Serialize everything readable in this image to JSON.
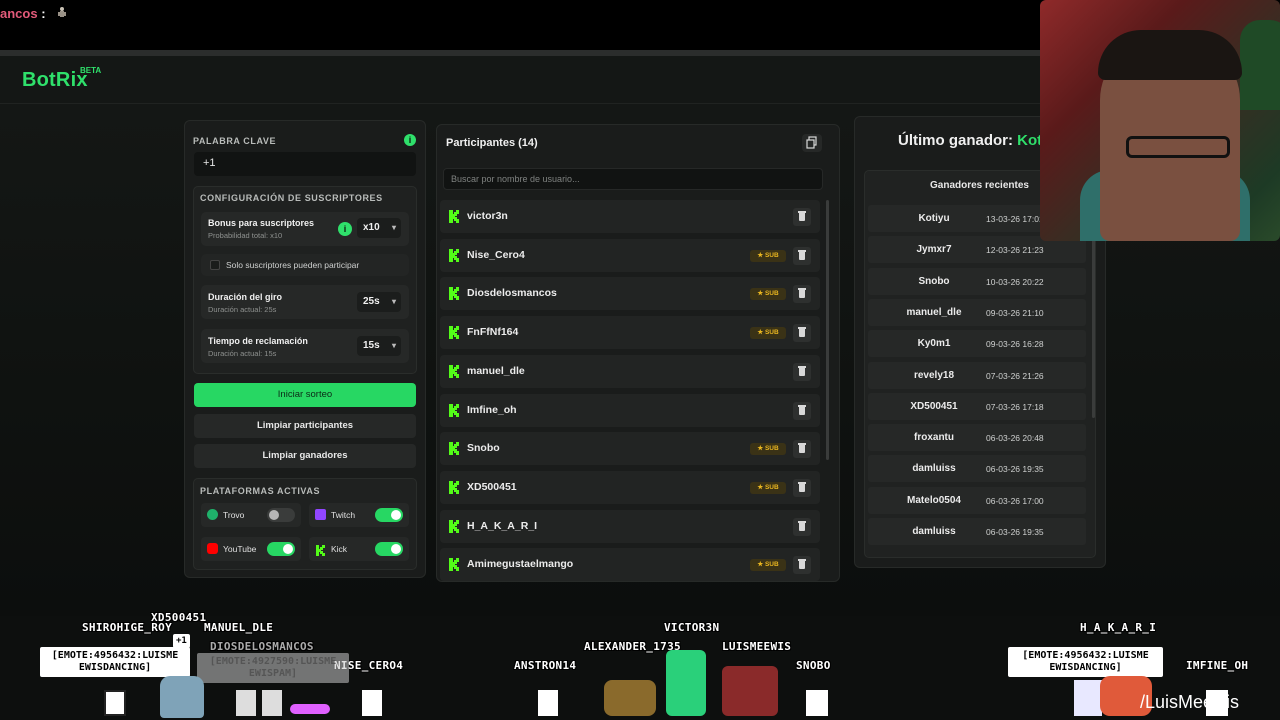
{
  "chat": {
    "name": "ancos",
    "colon": ":"
  },
  "app": {
    "logo": "BotRix",
    "beta": "BETA"
  },
  "left": {
    "keyword_label": "PALABRA CLAVE",
    "keyword_value": "+1",
    "sub_config_label": "CONFIGURACIÓN DE SUSCRIPTORES",
    "bonus_title": "Bonus para suscriptores",
    "bonus_sub": "Probabilidad total: x10",
    "bonus_value": "x10",
    "only_subs": "Solo suscriptores pueden participar",
    "spin_title": "Duración del giro",
    "spin_sub": "Duración actual: 25s",
    "spin_value": "25s",
    "claim_title": "Tiempo de reclamación",
    "claim_sub": "Duración actual: 15s",
    "claim_value": "15s",
    "btn_start": "Iniciar sorteo",
    "btn_clear_participants": "Limpiar participantes",
    "btn_clear_winners": "Limpiar ganadores",
    "platforms_label": "PLATAFORMAS ACTIVAS",
    "platforms": [
      {
        "name": "Trovo",
        "on": false,
        "color": "#1fb16a"
      },
      {
        "name": "Twitch",
        "on": true,
        "color": "#9146ff"
      },
      {
        "name": "YouTube",
        "on": true,
        "color": "#ff0000"
      },
      {
        "name": "Kick",
        "on": true,
        "color": "#53fc18"
      }
    ]
  },
  "participants": {
    "title": "Participantes (14)",
    "search_placeholder": "Buscar por nombre de usuario...",
    "badge_label": "★ SUB",
    "rows": [
      {
        "user": "victor3n",
        "sub": false
      },
      {
        "user": "Nise_Cero4",
        "sub": true
      },
      {
        "user": "Diosdelosmancos",
        "sub": true
      },
      {
        "user": "FnFfNf164",
        "sub": true
      },
      {
        "user": "manuel_dle",
        "sub": false
      },
      {
        "user": "Imfine_oh",
        "sub": false
      },
      {
        "user": "Snobo",
        "sub": true
      },
      {
        "user": "XD500451",
        "sub": true
      },
      {
        "user": "H_A_K_A_R_I",
        "sub": false
      },
      {
        "user": "Amimegustaelmango",
        "sub": true
      }
    ]
  },
  "winners": {
    "last_label": "Último ganador:",
    "last_name": "Kot",
    "recent_title": "Ganadores recientes",
    "rows": [
      {
        "name": "Kotiyu",
        "date": "13-03-26 17:01"
      },
      {
        "name": "Jymxr7",
        "date": "12-03-26 21:23"
      },
      {
        "name": "Snobo",
        "date": "10-03-26 20:22"
      },
      {
        "name": "manuel_dle",
        "date": "09-03-26 21:10"
      },
      {
        "name": "Ky0m1",
        "date": "09-03-26 16:28"
      },
      {
        "name": "revely18",
        "date": "07-03-26 21:26"
      },
      {
        "name": "XD500451",
        "date": "07-03-26 17:18"
      },
      {
        "name": "froxantu",
        "date": "06-03-26 20:48"
      },
      {
        "name": "damluiss",
        "date": "06-03-26 19:35"
      },
      {
        "name": "Matelo0504",
        "date": "06-03-26 17:00"
      },
      {
        "name": "damluiss",
        "date": "06-03-26 19:35"
      }
    ]
  },
  "overlay": {
    "names": [
      "XD500451",
      "SHIROHIGE_ROY",
      "MANUEL_DLE",
      "DIOSDELOSMANCOS",
      "NISE_CERO4",
      "ANSTRON14",
      "VICTOR3N",
      "ALEXANDER_1735",
      "LUISMEEWIS",
      "SNOBO",
      "H_A_K_A_R_I",
      "IMFINE_OH"
    ],
    "bubble1": "[EMOTE:4956432:LUISME EWISDANCING]",
    "bubble2": "[EMOTE:4927590:LUISME EWISPAM]",
    "bubble3": "[EMOTE:4956432:LUISME EWISDANCING]",
    "plus": "+1",
    "handle": "/LuisMeewis"
  }
}
